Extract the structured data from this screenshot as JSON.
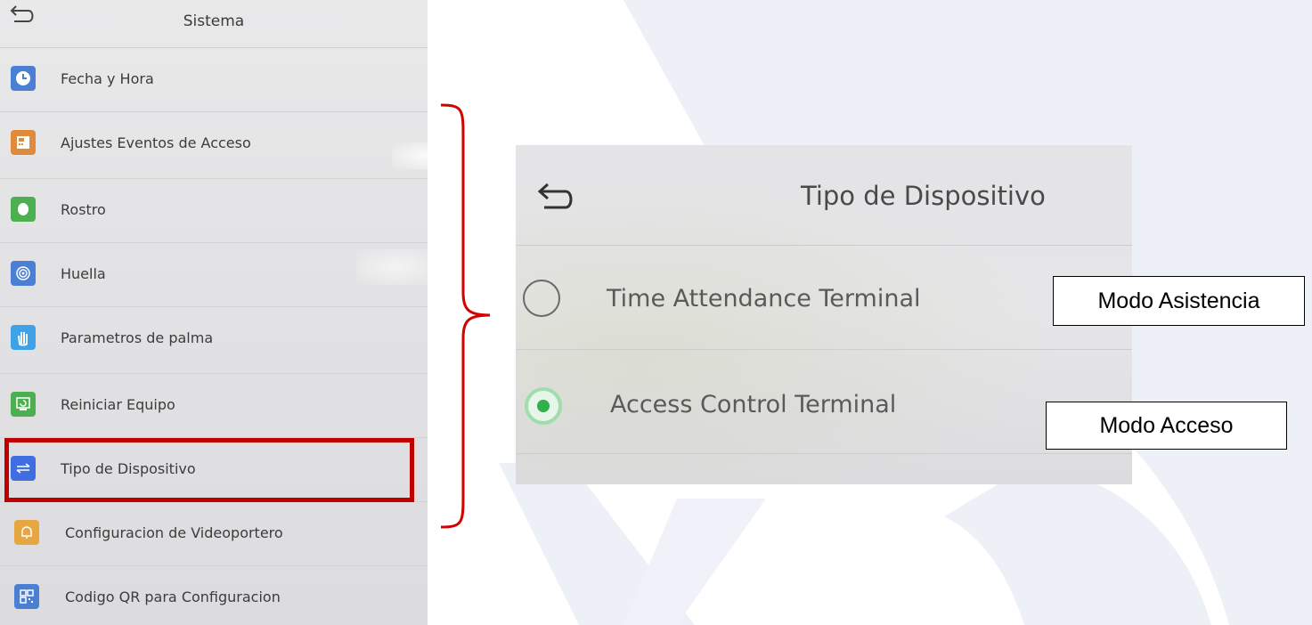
{
  "left_screen": {
    "title": "Sistema",
    "items": [
      {
        "label": "Fecha y Hora",
        "icon": "clock-icon",
        "color": "#4a7fd4"
      },
      {
        "label": "Ajustes Eventos de Acceso",
        "icon": "access-panel-icon",
        "color": "#e08a3c"
      },
      {
        "label": "Rostro",
        "icon": "face-icon",
        "color": "#4caf50"
      },
      {
        "label": "Huella",
        "icon": "fingerprint-icon",
        "color": "#4a7fd4"
      },
      {
        "label": "Parametros de palma",
        "icon": "palm-icon",
        "color": "#3fa2e6"
      },
      {
        "label": "Reiniciar Equipo",
        "icon": "restart-icon",
        "color": "#4caf50"
      },
      {
        "label": "Tipo de Dispositivo",
        "icon": "device-switch-icon",
        "color": "#3f6ee0"
      },
      {
        "label": "Configuracion de Videoportero",
        "icon": "bell-icon",
        "color": "#e6a640"
      },
      {
        "label": "Codigo QR para Configuracion",
        "icon": "qr-code-icon",
        "color": "#4a7fd4"
      }
    ],
    "highlighted_item": "Tipo de Dispositivo",
    "highlight_color": "#c00000"
  },
  "right_screen": {
    "title": "Tipo de Dispositivo",
    "options": [
      {
        "label": "Time Attendance Terminal",
        "selected": false
      },
      {
        "label": "Access Control Terminal",
        "selected": true
      }
    ],
    "selected_color": "#2fb04a"
  },
  "annotations": {
    "attendance_tag": "Modo Asistencia",
    "access_tag": "Modo Acceso"
  },
  "bracket_color": "#d40000"
}
